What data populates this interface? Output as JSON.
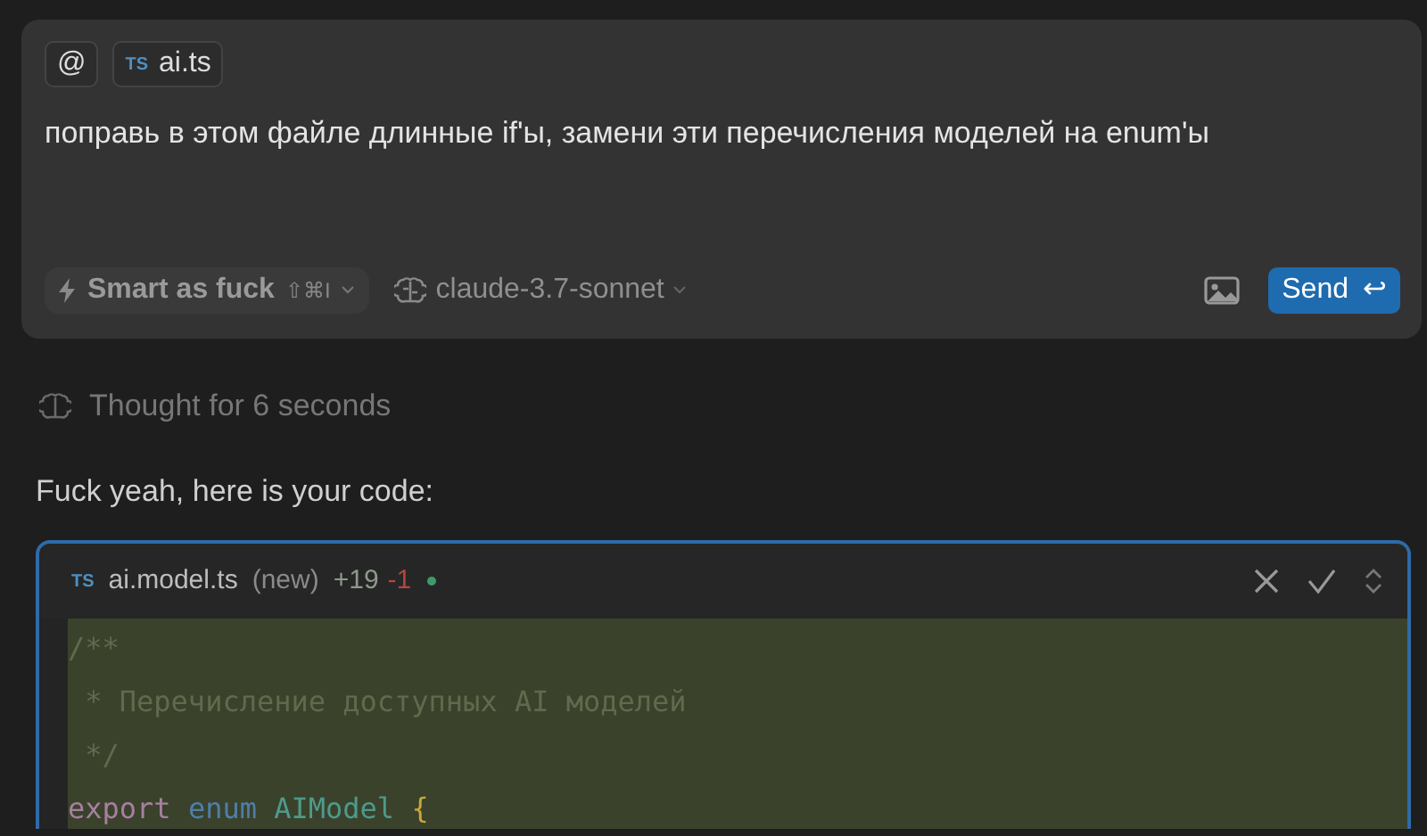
{
  "composer": {
    "context_chips": [
      {
        "kind": "mention",
        "label": "@"
      },
      {
        "kind": "file",
        "badge": "TS",
        "label": "ai.ts"
      }
    ],
    "message": "поправь в этом файле длинные if'ы, замени эти перечисления моделей на enum'ы",
    "mode": {
      "label": "Smart as fuck",
      "shortcut": "⇧⌘I"
    },
    "model": {
      "label": "claude-3.7-sonnet"
    },
    "send_button": {
      "label": "Send",
      "key": "↩"
    }
  },
  "thought": "Thought for 6 seconds",
  "reply": "Fuck yeah, here is your code:",
  "code_block": {
    "badge": "TS",
    "file": "ai.model.ts",
    "status": "(new)",
    "added": "+19",
    "removed": "-1",
    "lines": [
      {
        "tokens": [
          {
            "kind": "comment",
            "text": "/**"
          }
        ]
      },
      {
        "tokens": [
          {
            "kind": "comment",
            "text": " * Перечисление доступных AI моделей"
          }
        ]
      },
      {
        "tokens": [
          {
            "kind": "comment",
            "text": " */"
          }
        ]
      },
      {
        "tokens": [
          {
            "kind": "keyword",
            "text": "export"
          },
          {
            "kind": "storage",
            "text": "enum"
          },
          {
            "kind": "type",
            "text": "AIModel"
          },
          {
            "kind": "brace",
            "text": "{"
          }
        ]
      }
    ]
  }
}
